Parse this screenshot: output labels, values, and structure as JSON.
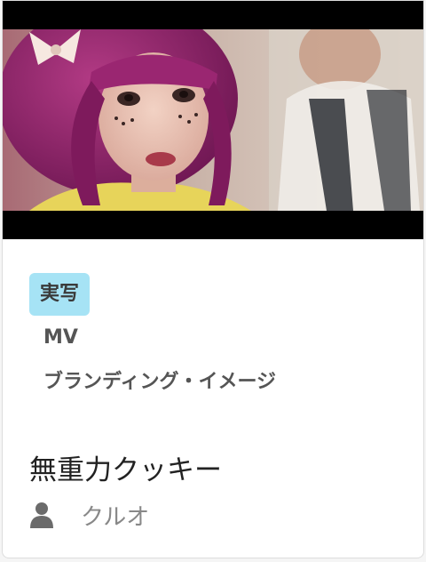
{
  "card": {
    "thumbnail_alt": "",
    "category_badge": "実写",
    "tags": [
      "MV",
      "ブランディング・イメージ"
    ],
    "title": "無重力クッキー",
    "author": "クルオ",
    "author_icon": "user-icon"
  },
  "colors": {
    "badge_bg": "#a6e3f5",
    "title": "#222222",
    "tag_text": "#555555",
    "author_text": "#888888",
    "border": "#dddddd"
  }
}
